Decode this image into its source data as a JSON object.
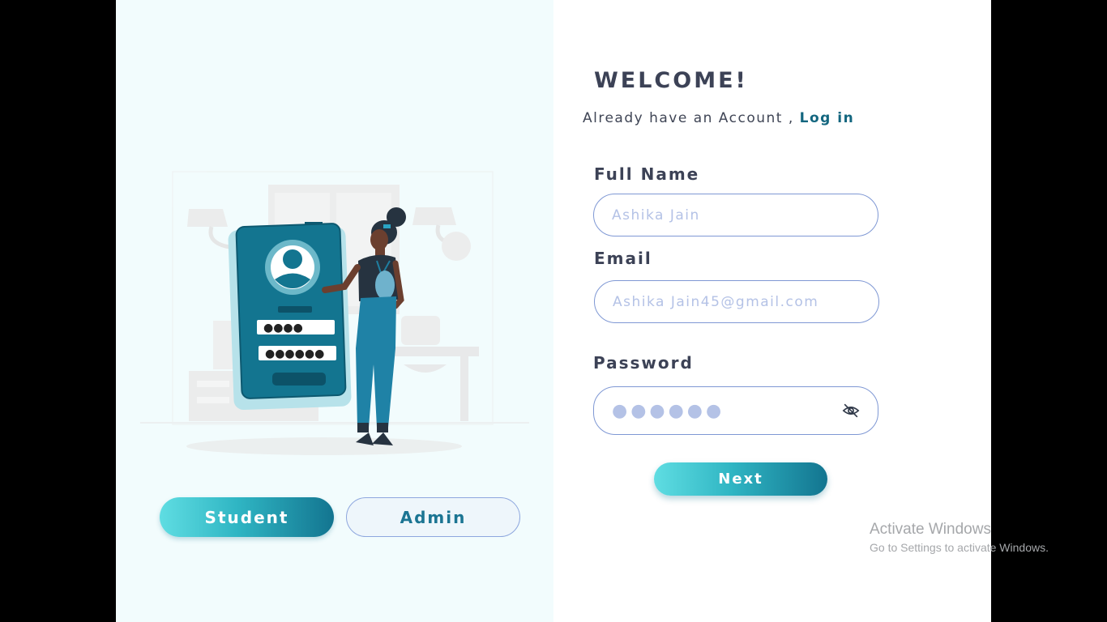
{
  "roles": {
    "student_label": "Student",
    "admin_label": "Admin"
  },
  "illustration": {
    "icon": "person-with-login-phone-illustration"
  },
  "form": {
    "title": "WELCOME!",
    "account_prompt": "Already have an Account ,",
    "login_link": "Log in",
    "full_name": {
      "label": "Full Name",
      "placeholder": "Ashika Jain"
    },
    "email": {
      "label": "Email",
      "placeholder": "Ashika Jain45@gmail.com"
    },
    "password": {
      "label": "Password",
      "masked_value": "●●●●●●",
      "toggle_icon": "eye-slash-icon"
    },
    "next_label": "Next"
  },
  "watermark": {
    "title": "Activate Windows",
    "subtitle": "Go to Settings to activate Windows."
  },
  "colors": {
    "accent": "#137590",
    "accent_light": "#5fdde2",
    "heading": "#3c4256",
    "input_border": "#7f98d4",
    "placeholder": "#b4c2e6",
    "left_panel_bg": "#f2fcfd"
  }
}
